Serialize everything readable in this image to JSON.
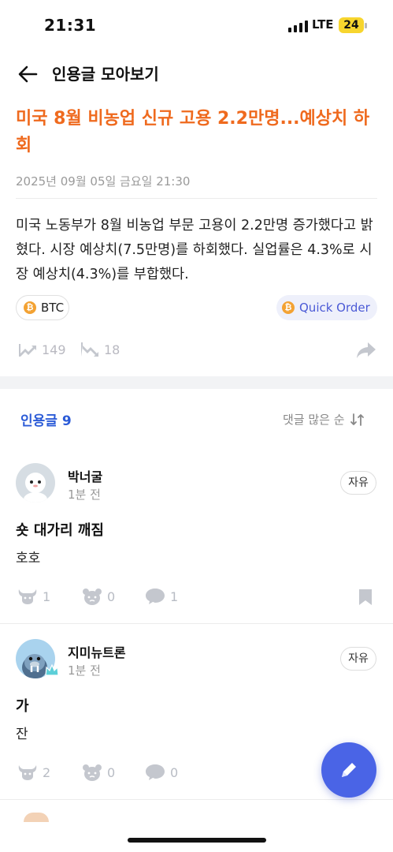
{
  "status_bar": {
    "time": "21:31",
    "network": "LTE",
    "battery": "24"
  },
  "header": {
    "title": "인용글 모아보기",
    "back_icon": "back-arrow-icon"
  },
  "article": {
    "headline": "미국 8월 비농업 신규 고용 2.2만명...예상치 하회",
    "datetime": "2025년 09월 05일 금요일 21:30",
    "body": "미국 노동부가 8월 비농업 부문 고용이 2.2만명 증가했다고 밝혔다. 시장 예상치(7.5만명)를 하회했다. 실업률은 4.3%로 시장 예상치(4.3%)를 부합했다.",
    "tags": {
      "coin_label": "BTC",
      "quick_order_label": "Quick Order"
    },
    "reactions": {
      "bullish_count": "149",
      "bearish_count": "18"
    }
  },
  "quotes": {
    "title": "인용글",
    "count": "9",
    "sort_label": "댓글 많은 순"
  },
  "comments": [
    {
      "username": "박너굴",
      "time": "1분 전",
      "tag": "자유",
      "title": "숏 대가리 깨짐",
      "body": "호호",
      "bull": "1",
      "bear": "0",
      "replies": "1"
    },
    {
      "username": "지미뉴트론",
      "time": "1분 전",
      "tag": "자유",
      "title": "가",
      "body": "잔",
      "bull": "2",
      "bear": "0",
      "replies": "0"
    }
  ],
  "colors": {
    "headline": "#ef6a1e",
    "accent": "#2b5bd7",
    "fab": "#4a64e6"
  }
}
